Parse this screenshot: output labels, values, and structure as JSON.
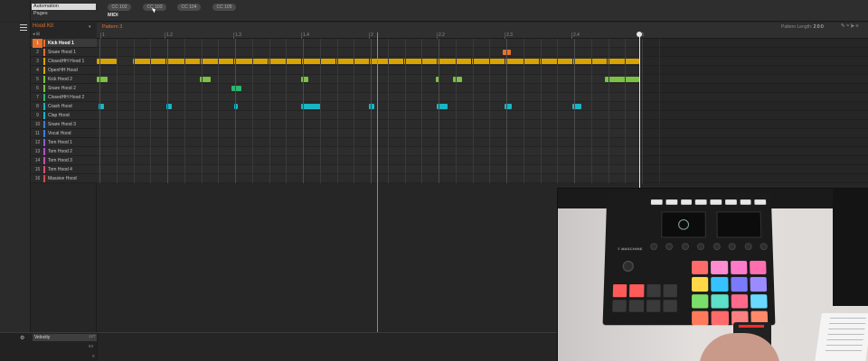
{
  "automation": {
    "field_value": "Automation",
    "pages_label": "Pages",
    "cc_buttons": [
      "CC 102",
      "CC 103",
      "CC 104",
      "CC 105"
    ],
    "midi_label": "MIDI"
  },
  "kit": {
    "title": "Hood Kit"
  },
  "sounds": [
    {
      "num": "1",
      "name": "Kick Hood 1",
      "color": "#e8702a",
      "selected": true
    },
    {
      "num": "2",
      "name": "Snare Hood 1",
      "color": "#e8702a"
    },
    {
      "num": "3",
      "name": "ClosedHH Hood 1",
      "color": "#d9a300"
    },
    {
      "num": "4",
      "name": "OpenHH Hood",
      "color": "#d9a300"
    },
    {
      "num": "5",
      "name": "Kick Hood 2",
      "color": "#7cc242"
    },
    {
      "num": "6",
      "name": "Snare Hood 2",
      "color": "#7cc242"
    },
    {
      "num": "7",
      "name": "ClosedHH Hood 2",
      "color": "#2fb36e"
    },
    {
      "num": "8",
      "name": "Crash Hood",
      "color": "#1ab5c4"
    },
    {
      "num": "9",
      "name": "Clap Hood",
      "color": "#1ab5c4"
    },
    {
      "num": "10",
      "name": "Snare Hood 3",
      "color": "#3b7fd9"
    },
    {
      "num": "11",
      "name": "Vocal Hood",
      "color": "#3b7fd9"
    },
    {
      "num": "12",
      "name": "Tom Hood 1",
      "color": "#8a5bd9"
    },
    {
      "num": "13",
      "name": "Tom Hood 2",
      "color": "#b04fc9"
    },
    {
      "num": "14",
      "name": "Tom Hood 3",
      "color": "#c94fa6"
    },
    {
      "num": "15",
      "name": "Tom Hood 4",
      "color": "#d94f6e"
    },
    {
      "num": "16",
      "name": "Massive Hood",
      "color": "#e04848"
    }
  ],
  "pattern": {
    "name": "Pattern 3",
    "length_label": "Pattern Length:",
    "length_value": "2:0:0",
    "ruler_ticks": [
      "1",
      "1.2",
      "1.3",
      "1.4",
      "2",
      "2.2",
      "2.3",
      "2.4",
      "3"
    ],
    "icons_text": "✎ ≈  |▸ ≡",
    "notes": {
      "lane3_row": [
        "#d9a300"
      ],
      "lane2_single_color": "#e8702a",
      "lane5_color": "#7cc242",
      "lane6_color": "#2fb36e",
      "lane8_color": "#1ab5c4"
    }
  },
  "velocity": {
    "label": "Velocity",
    "scale": [
      "127",
      "63",
      "0"
    ]
  },
  "camera": {
    "device_label": "≡ MASCHINE"
  }
}
